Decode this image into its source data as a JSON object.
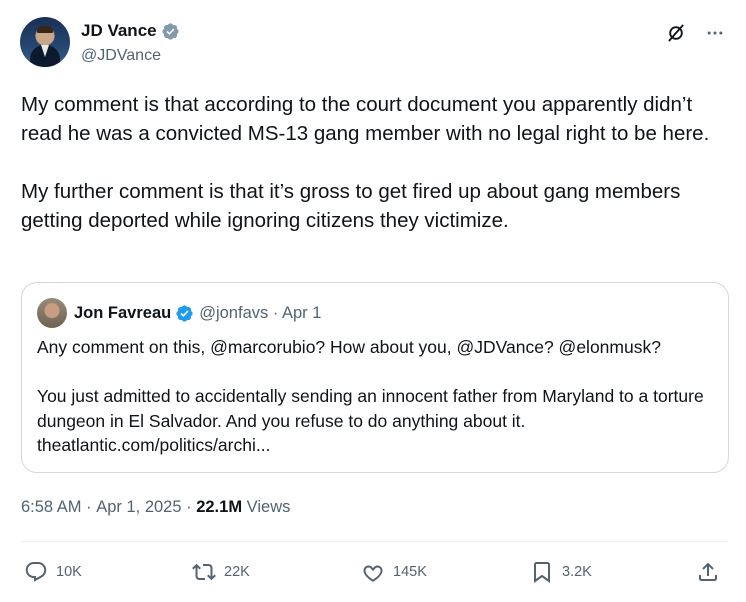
{
  "author": {
    "display_name": "JD Vance",
    "handle": "@JDVance",
    "badge": "grey-verified-icon"
  },
  "header_icons": [
    "grok-icon",
    "more-icon"
  ],
  "tweet": {
    "text": "My comment is that according to the court document you apparently didn’t read he was a convicted MS-13 gang member with no legal right to be here.\n\nMy further comment is that it’s gross to get fired up about gang members getting deported while ignoring citizens they victimize."
  },
  "quote": {
    "display_name": "Jon Favreau",
    "handle_date": "@jonfavs · Apr 1",
    "badge": "blue-verified-icon",
    "text": "Any comment on this, @marcorubio? How about you, @JDVance? @elonmusk?\n\nYou just admitted to accidentally sending an innocent father from Maryland to a torture dungeon in El Salvador. And you refuse to do anything about it. theatlantic.com/politics/archi..."
  },
  "meta": {
    "time": "6:58 AM",
    "separator": " · ",
    "date": "Apr 1, 2025",
    "views_count": "22.1M",
    "views_label": " Views"
  },
  "actions": {
    "replies": "10K",
    "reposts": "22K",
    "likes": "145K",
    "bookmarks": "3.2K"
  },
  "colors": {
    "text": "#0f1419",
    "secondary": "#536471",
    "border": "#cfd9de",
    "verified_blue": "#1d9bf0",
    "verified_grey": "#829aab"
  }
}
